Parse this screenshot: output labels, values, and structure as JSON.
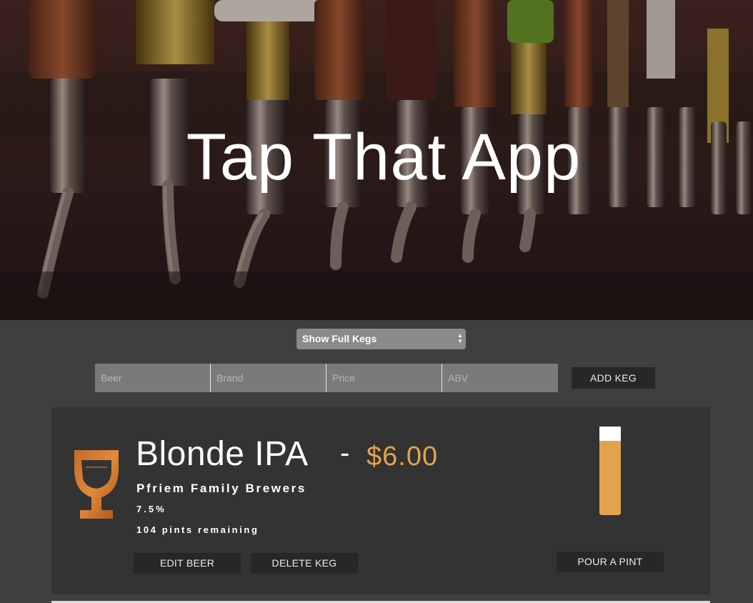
{
  "app": {
    "title": "Tap That App"
  },
  "filter": {
    "selected": "Show Full Kegs"
  },
  "add_form": {
    "beer_placeholder": "Beer",
    "brand_placeholder": "Brand",
    "price_placeholder": "Price",
    "abv_placeholder": "ABV",
    "add_label": "ADD KEG"
  },
  "keg": {
    "name": "Blonde IPA",
    "separator": "-",
    "price": "$6.00",
    "brand": "Pfriem Family Brewers",
    "abv": "7.5%",
    "pints_text": "104 pints remaining",
    "pints_remaining": 104,
    "pints_total": 124,
    "edit_label": "EDIT BEER",
    "delete_label": "DELETE KEG",
    "pour_label": "POUR A PINT"
  },
  "colors": {
    "accent": "#e2a24e",
    "background": "#3f3f3f",
    "card": "#333333",
    "button": "#272727"
  },
  "icons": {
    "glass": "beer-glass-icon",
    "select_arrows": "sort-arrows-icon"
  }
}
